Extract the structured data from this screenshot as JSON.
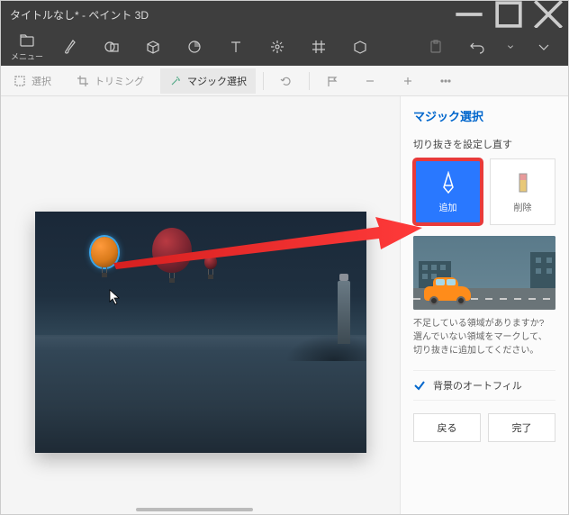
{
  "titlebar": {
    "title": "タイトルなし* - ペイント 3D"
  },
  "toolbar": {
    "menu_label": "メニュー"
  },
  "subtoolbar": {
    "select": "選択",
    "trim": "トリミング",
    "magic": "マジック選択"
  },
  "sidebar": {
    "title": "マジック選択",
    "subtitle": "切り抜きを設定し直す",
    "add_label": "追加",
    "remove_label": "削除",
    "desc": "不足している領域がありますか? 選んでいない領域をマークして、切り抜きに追加してください。",
    "autofill": "背景のオートフィル",
    "back": "戻る",
    "done": "完了"
  }
}
